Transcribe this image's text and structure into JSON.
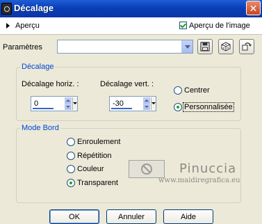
{
  "window": {
    "title": "Décalage",
    "close_symbol": "✕"
  },
  "preview": {
    "label": "Aperçu",
    "checkbox_label": "Aperçu de l'image",
    "checkbox_checked": true
  },
  "params": {
    "label": "Paramètres",
    "value": ""
  },
  "offset_group": {
    "legend": "Décalage",
    "horizontal_label": "Décalage horiz. :",
    "horizontal_value": "0",
    "vertical_label": "Décalage vert. :",
    "vertical_value": "-30",
    "options": [
      {
        "label": "Centrer",
        "checked": false
      },
      {
        "label": "Personnalisée",
        "checked": true
      }
    ]
  },
  "edge_group": {
    "legend": "Mode Bord",
    "options": [
      {
        "label": "Enroulement",
        "checked": false
      },
      {
        "label": "Répétition",
        "checked": false
      },
      {
        "label": "Couleur",
        "checked": false
      },
      {
        "label": "Transparent",
        "checked": true
      }
    ]
  },
  "watermark": {
    "name": "Pinuccia",
    "url": "www.maidiregrafica.eu"
  },
  "buttons": {
    "ok": "OK",
    "cancel": "Annuler",
    "help": "Aide"
  },
  "colors": {
    "titlebar": "#0a3fb8",
    "accent_text": "#0046d5",
    "check_green": "#21a121",
    "dialog_bg": "#ece9d8"
  }
}
